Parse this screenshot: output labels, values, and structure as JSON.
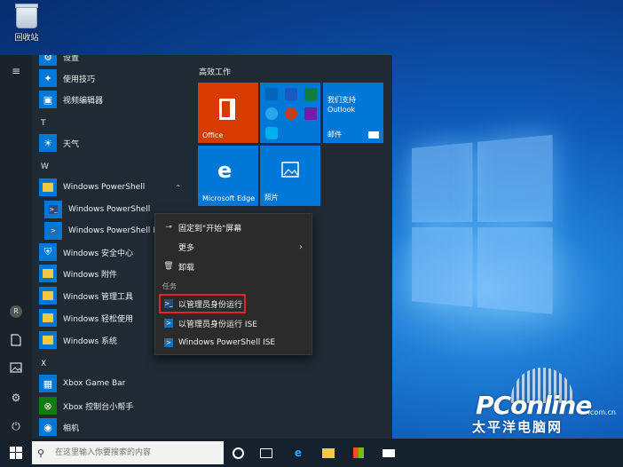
{
  "desktop": {
    "recycle_bin_label": "回收站"
  },
  "rail": {
    "icons": [
      "hamburger-icon",
      "user-icon",
      "document-icon",
      "pictures-icon",
      "settings-icon",
      "power-icon"
    ],
    "user_initial": "R"
  },
  "applist": {
    "items_top": [
      {
        "label": "设置",
        "icon": "gear-icon"
      },
      {
        "label": "使用技巧",
        "icon": "lightbulb-icon"
      },
      {
        "label": "视频编辑器",
        "icon": "image-icon"
      }
    ],
    "letter_t": "T",
    "weather": {
      "label": "天气",
      "icon": "sun-icon"
    },
    "letter_w": "W",
    "powershell_folder": "Windows PowerShell",
    "powershell": "Windows PowerShell",
    "powershell_ise": "Windows PowerShell ISE",
    "w_items": [
      {
        "label": "Windows 安全中心",
        "icon": "shield-icon"
      },
      {
        "label": "Windows 附件",
        "icon": "folder-icon"
      },
      {
        "label": "Windows 管理工具",
        "icon": "folder-icon"
      },
      {
        "label": "Windows 轻松使用",
        "icon": "folder-icon"
      },
      {
        "label": "Windows 系统",
        "icon": "folder-icon"
      }
    ],
    "letter_x": "X",
    "x_items": [
      {
        "label": "Xbox Game Bar",
        "icon": "xbox-icon"
      },
      {
        "label": "Xbox 控制台小帮手",
        "icon": "xbox-icon"
      },
      {
        "label": "相机",
        "icon": "camera-icon"
      }
    ]
  },
  "tiles": {
    "group_title": "高效工作",
    "office": "Office",
    "mail_top": "我们支持",
    "mail_mid": "Outlook",
    "mail": "邮件",
    "edge": "Microsoft Edge",
    "photos": "照片"
  },
  "context_menu": {
    "pin": "固定到\"开始\"屏幕",
    "more": "更多",
    "uninstall": "卸载",
    "tasks_header": "任务",
    "run_admin": "以管理员身份运行",
    "run_admin_ise": "以管理员身份运行 ISE",
    "ps_ise": "Windows PowerShell ISE"
  },
  "taskbar": {
    "search_placeholder": "在这里输入你要搜索的内容"
  },
  "watermark": {
    "brand": "PConline",
    "domain": ".com.cn",
    "cn": "太平洋电脑网"
  },
  "colors": {
    "office_tile": "#d83b01",
    "tile_blue": "#0078d7",
    "menu_bg": "#2b2b2b",
    "start_bg": "#1f2a35",
    "highlight": "#e0242a"
  }
}
